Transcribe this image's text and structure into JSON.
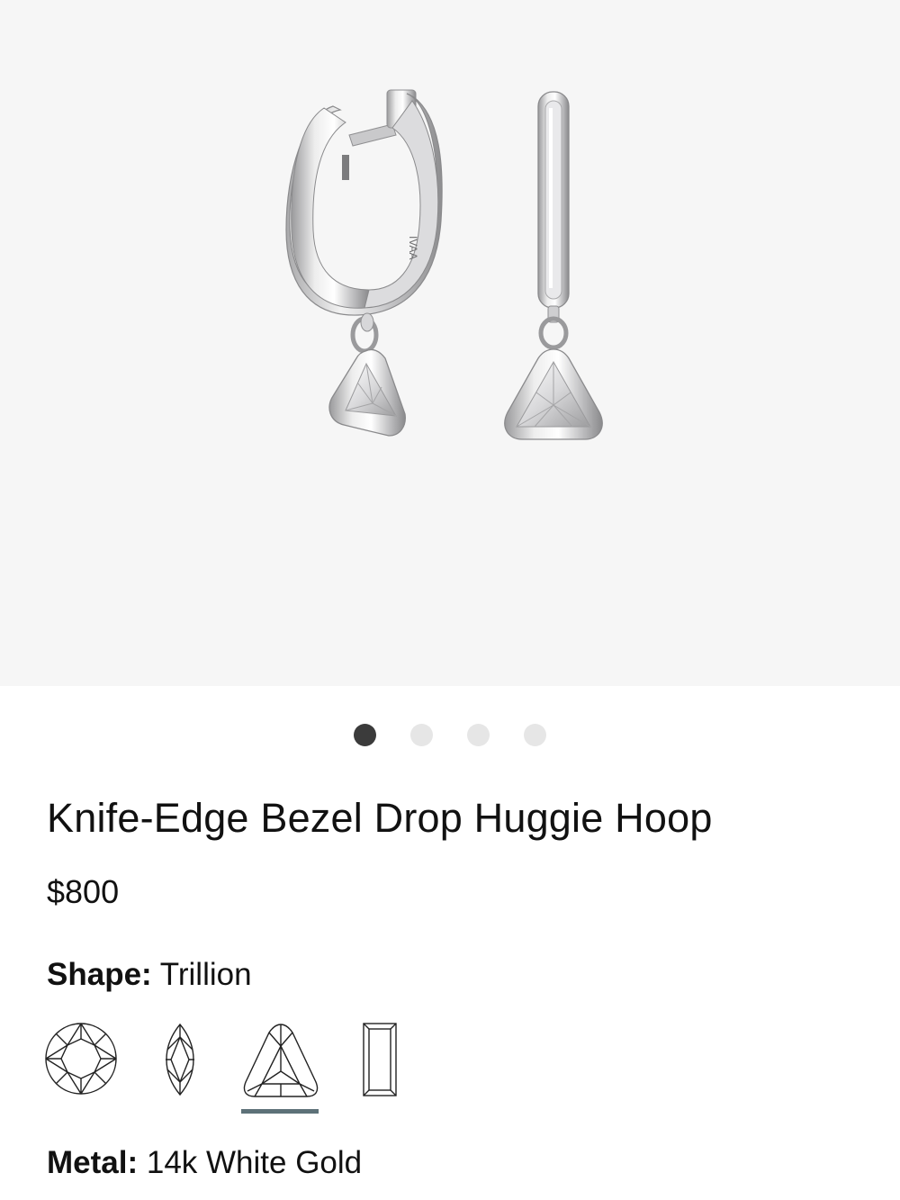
{
  "gallery": {
    "image_alt": "Knife-Edge Bezel Drop Huggie Hoop earrings",
    "engraving": "IVAA",
    "slide_count": 4,
    "active_slide": 1
  },
  "product": {
    "title": "Knife-Edge Bezel Drop Huggie Hoop",
    "price": "$800"
  },
  "options": {
    "shape": {
      "label": "Shape:",
      "value": "Trillion",
      "choices": [
        {
          "name": "Round",
          "icon": "round-diamond-icon"
        },
        {
          "name": "Marquise",
          "icon": "marquise-diamond-icon"
        },
        {
          "name": "Trillion",
          "icon": "trillion-diamond-icon",
          "selected": true
        },
        {
          "name": "Baguette",
          "icon": "baguette-diamond-icon"
        }
      ]
    },
    "metal": {
      "label": "Metal:",
      "value": "14k White Gold"
    }
  },
  "colors": {
    "gallery_bg": "#f6f6f6",
    "dot_active": "#3b3b3b",
    "dot_inactive": "#e6e6e6",
    "selected_underline": "#5d7178"
  }
}
